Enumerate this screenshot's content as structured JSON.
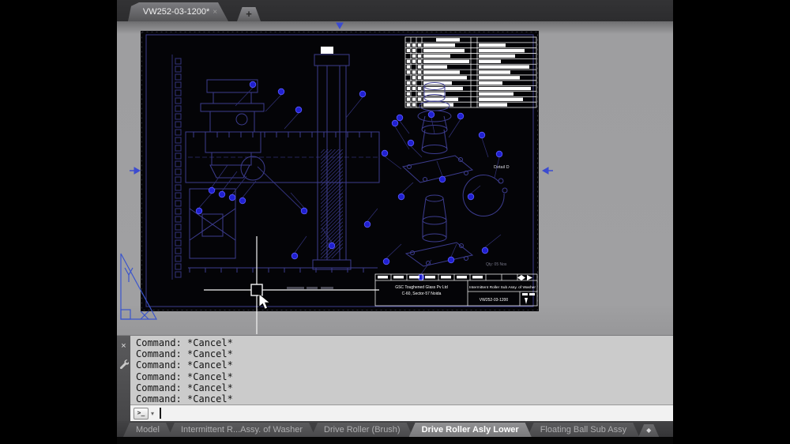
{
  "window": {
    "file_tab_label": "VW252-03-1200*",
    "close_glyph": "×",
    "new_tab_glyph": "+"
  },
  "canvas": {
    "detail_label": "Detail D",
    "qty_label": "Qty: 05 Nos",
    "title_block": {
      "company_line1": "GSC Toughened Glass Pv Ltd",
      "company_line2": "C-60, Sector-57 Noida",
      "drawing_title": "Intermittent Roller Sub Assy. of Washer",
      "drawing_number": "VW252-03-1200"
    }
  },
  "command_window": {
    "lines": [
      "Command: *Cancel*",
      "Command: *Cancel*",
      "Command: *Cancel*",
      "Command: *Cancel*",
      "Command: *Cancel*",
      "Command: *Cancel*"
    ],
    "prompt_glyph": ">_",
    "dropdown_glyph": "▾"
  },
  "layout_tabs": {
    "tabs": [
      {
        "label": "Model",
        "active": false
      },
      {
        "label": "Intermittent R...Assy. of Washer",
        "active": false
      },
      {
        "label": "Drive Roller (Brush)",
        "active": false
      },
      {
        "label": "Drive Roller Asly Lower",
        "active": true
      },
      {
        "label": "Floating Ball Sub Assy",
        "active": false
      }
    ],
    "overflow_glyph": "◆"
  },
  "colors": {
    "drawing_line_blue": "#3c3c8e",
    "balloon_blue": "#2020d0",
    "viewport_gray": "#a0a0a2",
    "paper_black": "#040407"
  }
}
